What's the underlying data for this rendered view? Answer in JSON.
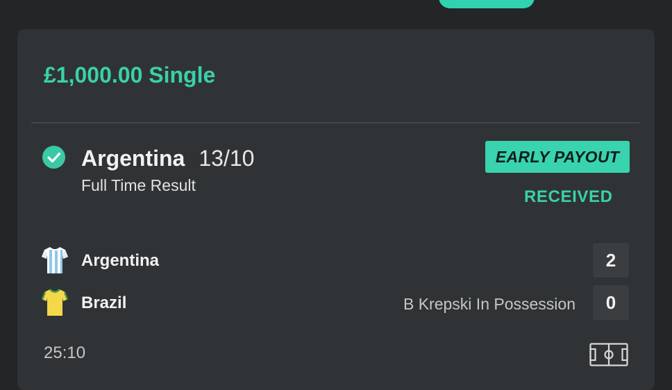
{
  "bet": {
    "title": "£1,000.00 Single"
  },
  "selection": {
    "name": "Argentina",
    "odds": "13/10",
    "market": "Full Time Result",
    "badge": "EARLY PAYOUT",
    "status": "RECEIVED"
  },
  "match": {
    "home": {
      "name": "Argentina",
      "score": "2",
      "shirt_colors": [
        "#ffffff",
        "#8fc6e8"
      ]
    },
    "away": {
      "name": "Brazil",
      "score": "0",
      "shirt_colors": [
        "#f5d84a",
        "#3c9b4a"
      ]
    },
    "possession": "B Krepski In Possession",
    "clock": "25:10"
  },
  "colors": {
    "accent": "#3ad1a9",
    "card": "#303335",
    "background": "#232527"
  },
  "icons": {
    "check": "check-circle-icon",
    "pitch": "football-pitch-icon"
  }
}
